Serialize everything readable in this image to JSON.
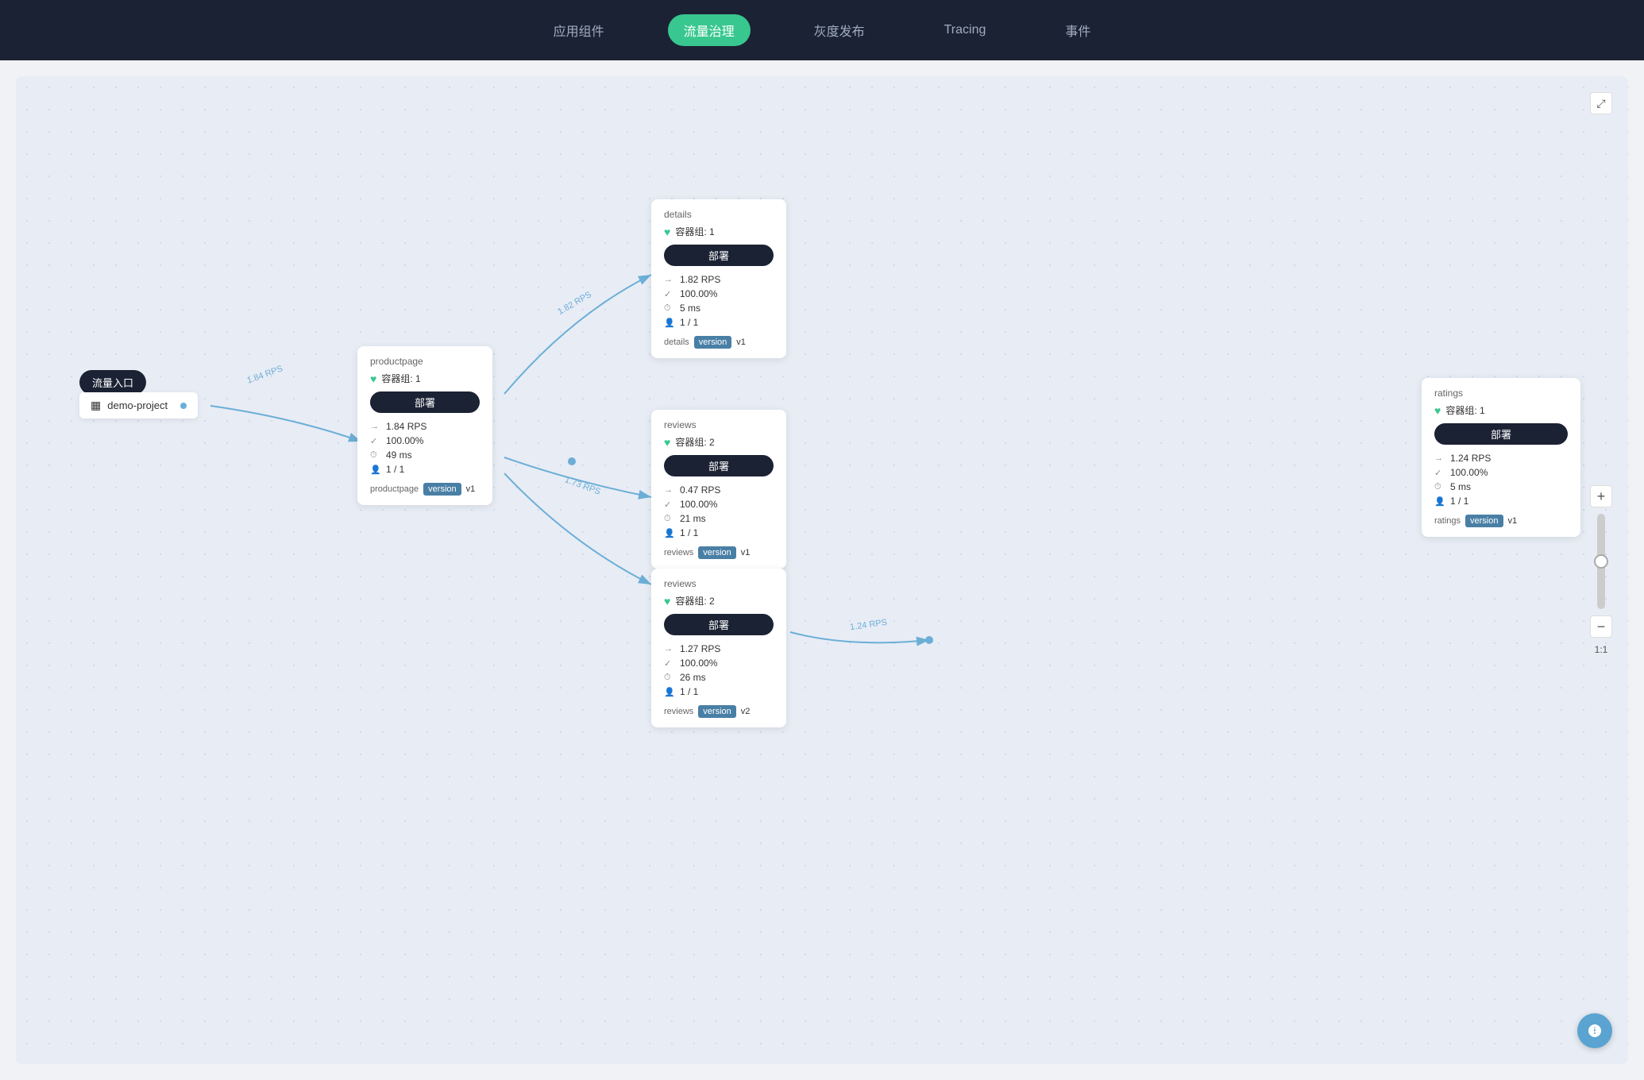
{
  "header": {
    "nav_items": [
      {
        "id": "app-components",
        "label": "应用组件",
        "active": false
      },
      {
        "id": "traffic-control",
        "label": "流量治理",
        "active": true
      },
      {
        "id": "gray-release",
        "label": "灰度发布",
        "active": false
      },
      {
        "id": "tracing",
        "label": "Tracing",
        "active": false
      },
      {
        "id": "events",
        "label": "事件",
        "active": false
      }
    ]
  },
  "zoom": {
    "expand_label": "⤢",
    "plus_label": "+",
    "minus_label": "−",
    "ratio": "1:1"
  },
  "nodes": {
    "entry": {
      "label": "流量入口"
    },
    "source": {
      "icon": "▦",
      "name": "demo-project"
    },
    "productpage": {
      "title": "productpage",
      "container_label": "容器组:",
      "container_count": "1",
      "deploy_label": "部署",
      "metrics": {
        "rps": "1.84 RPS",
        "success_rate": "100.00%",
        "latency": "49 ms",
        "instances": "1 / 1"
      },
      "footer_label": "productpage",
      "version_key": "version",
      "version_value": "v1"
    },
    "details": {
      "title": "details",
      "container_label": "容器组:",
      "container_count": "1",
      "deploy_label": "部署",
      "metrics": {
        "rps": "1.82 RPS",
        "success_rate": "100.00%",
        "latency": "5 ms",
        "instances": "1 / 1"
      },
      "footer_label": "details",
      "version_key": "version",
      "version_value": "v1"
    },
    "reviews_v1": {
      "title": "reviews",
      "container_label": "容器组:",
      "container_count": "2",
      "deploy_label": "部署",
      "metrics": {
        "rps": "0.47 RPS",
        "success_rate": "100.00%",
        "latency": "21 ms",
        "instances": "1 / 1"
      },
      "footer_label": "reviews",
      "version_key": "version",
      "version_value": "v1"
    },
    "reviews_v2": {
      "title": "reviews",
      "container_label": "容器组:",
      "container_count": "2",
      "deploy_label": "部署",
      "metrics": {
        "rps": "1.27 RPS",
        "success_rate": "100.00%",
        "latency": "26 ms",
        "instances": "1 / 1"
      },
      "footer_label": "reviews",
      "version_key": "version",
      "version_value": "v2"
    },
    "ratings": {
      "title": "ratings",
      "container_label": "容器组:",
      "container_count": "1",
      "deploy_label": "部署",
      "metrics": {
        "rps": "1.24 RPS",
        "success_rate": "100.00%",
        "latency": "5 ms",
        "instances": "1 / 1"
      },
      "footer_label": "ratings",
      "version_key": "version",
      "version_value": "v1"
    }
  },
  "rps_labels": {
    "to_productpage": "1.84 RPS",
    "to_details": "1.82 RPS",
    "to_reviews": "1.73 RPS",
    "to_ratings": "1.24 RPS"
  },
  "help_button": "↗"
}
